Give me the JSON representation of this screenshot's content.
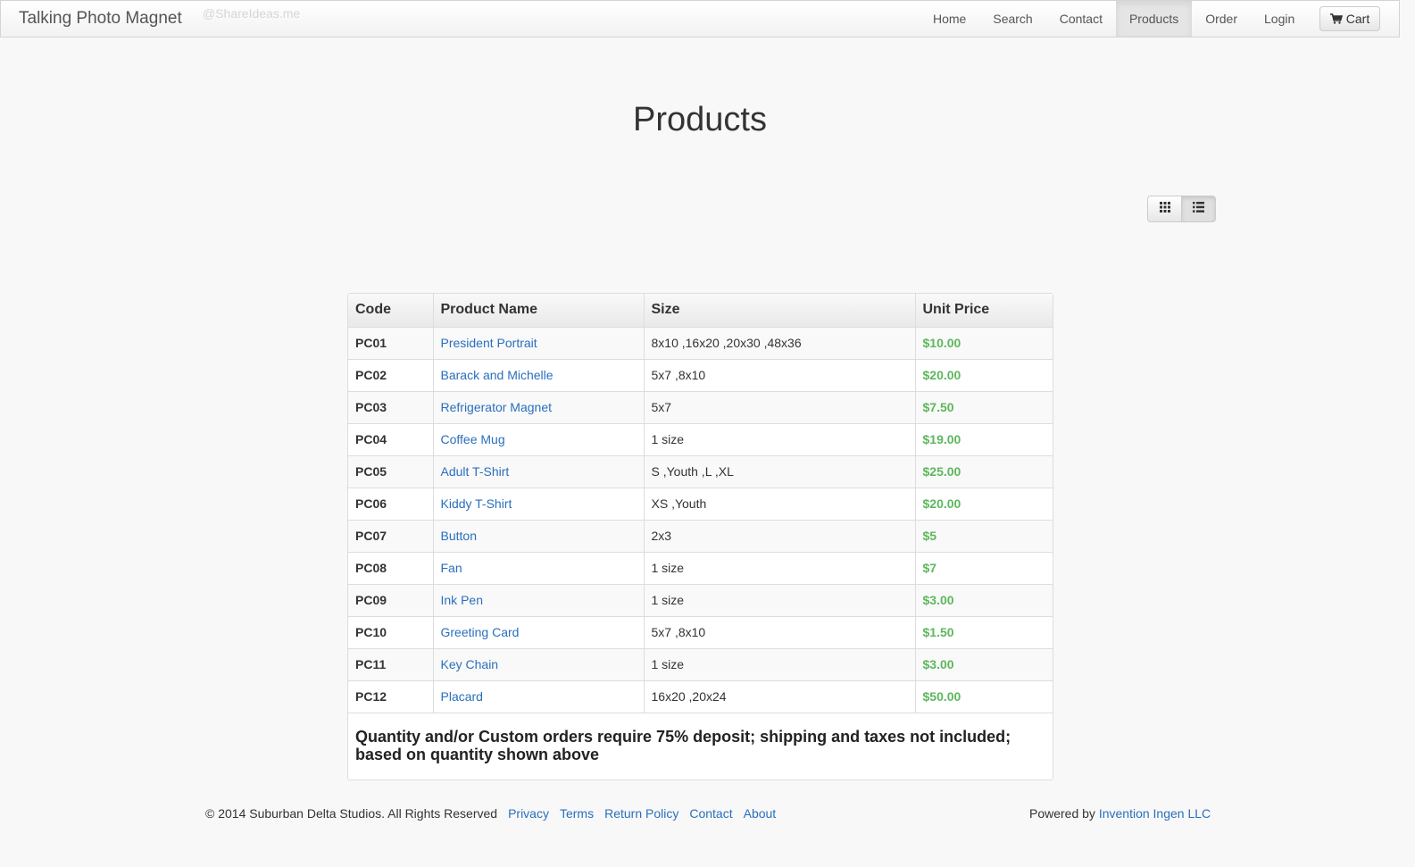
{
  "navbar": {
    "brand": "Talking Photo Magnet",
    "watermark": "@ShareIdeas.me",
    "items": [
      {
        "label": "Home",
        "active": false
      },
      {
        "label": "Search",
        "active": false
      },
      {
        "label": "Contact",
        "active": false
      },
      {
        "label": "Products",
        "active": true
      },
      {
        "label": "Order",
        "active": false
      },
      {
        "label": "Login",
        "active": false
      }
    ],
    "cart_label": "Cart",
    "cart_icon": "shopping-cart-icon"
  },
  "page": {
    "title": "Products"
  },
  "view_toggle": {
    "grid_icon": "grid-view-icon",
    "list_icon": "list-view-icon",
    "active": "list"
  },
  "table": {
    "headers": [
      "Code",
      "Product Name",
      "Size",
      "Unit Price"
    ],
    "rows": [
      {
        "code": "PC01",
        "name": "President Portrait",
        "size": "8x10 ,16x20 ,20x30 ,48x36",
        "price": "$10.00"
      },
      {
        "code": "PC02",
        "name": "Barack and Michelle",
        "size": "5x7 ,8x10",
        "price": "$20.00"
      },
      {
        "code": "PC03",
        "name": "Refrigerator Magnet",
        "size": "5x7",
        "price": "$7.50"
      },
      {
        "code": "PC04",
        "name": "Coffee Mug",
        "size": "1 size",
        "price": "$19.00"
      },
      {
        "code": "PC05",
        "name": "Adult T-Shirt",
        "size": "S ,Youth ,L ,XL",
        "price": "$25.00"
      },
      {
        "code": "PC06",
        "name": "Kiddy T-Shirt",
        "size": "XS ,Youth",
        "price": "$20.00"
      },
      {
        "code": "PC07",
        "name": "Button",
        "size": "2x3",
        "price": "$5"
      },
      {
        "code": "PC08",
        "name": "Fan",
        "size": "1 size",
        "price": "$7"
      },
      {
        "code": "PC09",
        "name": "Ink Pen",
        "size": "1 size",
        "price": "$3.00"
      },
      {
        "code": "PC10",
        "name": "Greeting Card",
        "size": "5x7 ,8x10",
        "price": "$1.50"
      },
      {
        "code": "PC11",
        "name": "Key Chain",
        "size": "1 size",
        "price": "$3.00"
      },
      {
        "code": "PC12",
        "name": "Placard",
        "size": "16x20 ,20x24",
        "price": "$50.00"
      }
    ],
    "note": "Quantity and/or Custom orders require 75% deposit; shipping and taxes not included; based on quantity shown above"
  },
  "footer": {
    "copyright": "© 2014 Suburban Delta Studios. All Rights Reserved",
    "links": [
      "Privacy",
      "Terms",
      "Return Policy",
      "Contact",
      "About"
    ],
    "powered_prefix": "Powered by",
    "powered_link": "Invention Ingen LLC"
  },
  "colors": {
    "link": "#2a6fbd",
    "price": "#5cb85c",
    "background": "#f8f8f8"
  }
}
